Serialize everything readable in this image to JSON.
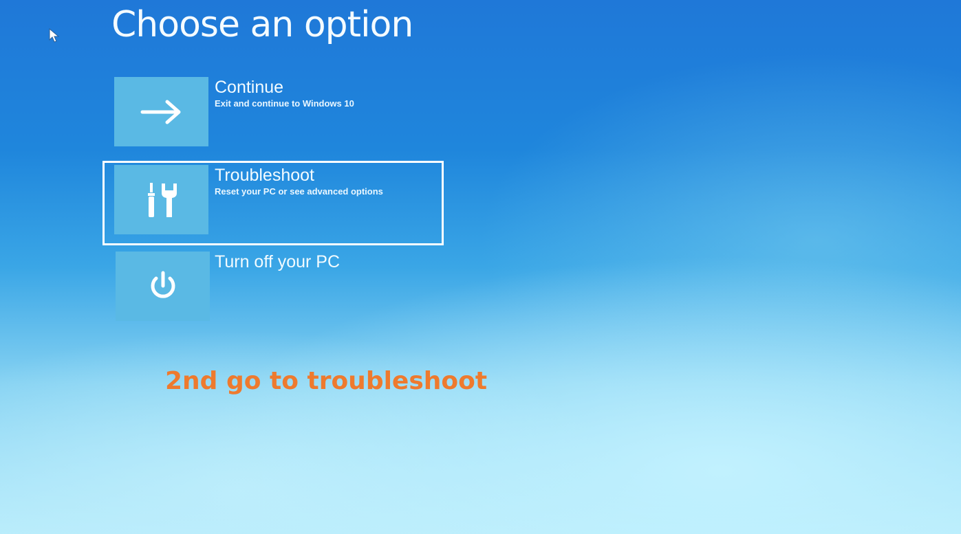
{
  "screen": {
    "title": "Choose an option"
  },
  "options": [
    {
      "label": "Continue",
      "description": "Exit and continue to Windows 10",
      "icon": "arrow-right-icon"
    },
    {
      "label": "Troubleshoot",
      "description": "Reset your PC or see advanced options",
      "icon": "tools-icon",
      "selected": true
    },
    {
      "label": "Turn off your PC",
      "description": "",
      "icon": "power-icon"
    }
  ],
  "annotation": {
    "text": "2nd go to troubleshoot",
    "color": "#ee7a2e"
  },
  "colors": {
    "background_top": "#1f78d8",
    "background_bottom": "#b8ecfb",
    "tile": "#5ab9e4"
  }
}
